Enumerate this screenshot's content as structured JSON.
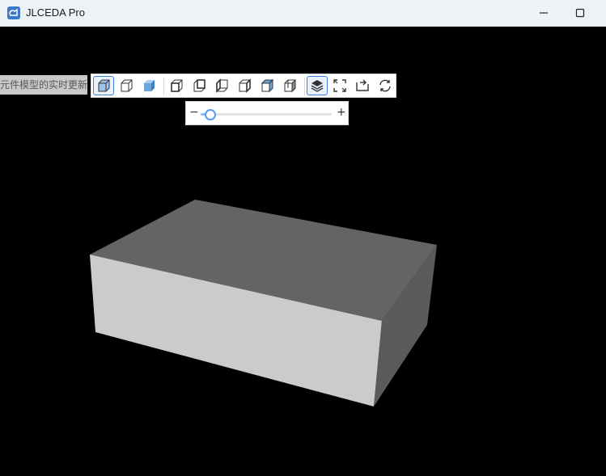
{
  "window": {
    "title": "JLCEDA Pro"
  },
  "viewer": {
    "hint_text": "元件模型的实时更新",
    "toolbar": {
      "buttons": [
        {
          "name": "view-iso-shaded-button",
          "icon": "cube-shaded-icon",
          "active": true
        },
        {
          "name": "view-iso-wire-button",
          "icon": "cube-outline-icon",
          "active": false
        },
        {
          "name": "view-iso-solid-button",
          "icon": "cube-solid-icon",
          "active": false
        },
        {
          "name": "view-front-button",
          "icon": "cube-front-icon",
          "active": false
        },
        {
          "name": "view-back-button",
          "icon": "cube-back-icon",
          "active": false
        },
        {
          "name": "view-left-button",
          "icon": "cube-left-icon",
          "active": false
        },
        {
          "name": "view-right-button",
          "icon": "cube-right-icon",
          "active": false
        },
        {
          "name": "view-top-button",
          "icon": "cube-top-icon",
          "active": false
        },
        {
          "name": "view-bottom-button",
          "icon": "cube-bottom-icon",
          "active": false
        },
        {
          "name": "layers-button",
          "icon": "layers-icon",
          "active": true
        },
        {
          "name": "fit-view-button",
          "icon": "fullscreen-icon",
          "active": false
        },
        {
          "name": "flip-button",
          "icon": "flip-arrow-icon",
          "active": false
        },
        {
          "name": "refresh-button",
          "icon": "refresh-icon",
          "active": false
        }
      ]
    },
    "slider": {
      "minus_label": "−",
      "plus_label": "+",
      "value_fraction": 0.07
    },
    "colors": {
      "background": "#000000",
      "box_top": "#646464",
      "box_front": "#cbcbcb",
      "box_side": "#5b5b5b",
      "accent": "#3d7fe0"
    }
  }
}
